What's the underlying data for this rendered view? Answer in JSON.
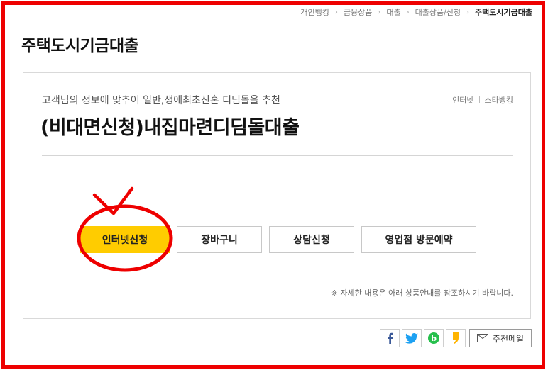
{
  "breadcrumb": [
    "개인뱅킹",
    "금융상품",
    "대출",
    "대출상품/신청",
    "주택도시기금대출"
  ],
  "page_title": "주택도시기금대출",
  "product": {
    "description": "고객님의 정보에 맞추어 일반,생애최초신혼 디딤돌을 추천",
    "name": "(비대면신청)내집마련디딤돌대출",
    "channels": [
      "인터넷",
      "스타뱅킹"
    ]
  },
  "actions": {
    "internet_apply": "인터넷신청",
    "cart": "장바구니",
    "consult": "상담신청",
    "branch_visit": "영업점 방문예약"
  },
  "note": "※ 자세한 내용은 아래 상품안내를 참조하시기 바랍니다.",
  "share": {
    "icons": [
      "facebook-icon",
      "twitter-icon",
      "band-icon",
      "kakaostory-icon",
      "mail-icon"
    ],
    "mail_label": "추천메일"
  },
  "colors": {
    "accent_yellow": "#ffcc00",
    "annotation_red": "#ee0000",
    "facebook": "#3b5998",
    "twitter": "#1da1f2",
    "band": "#27c04d",
    "kakaostory": "#ffb400"
  }
}
